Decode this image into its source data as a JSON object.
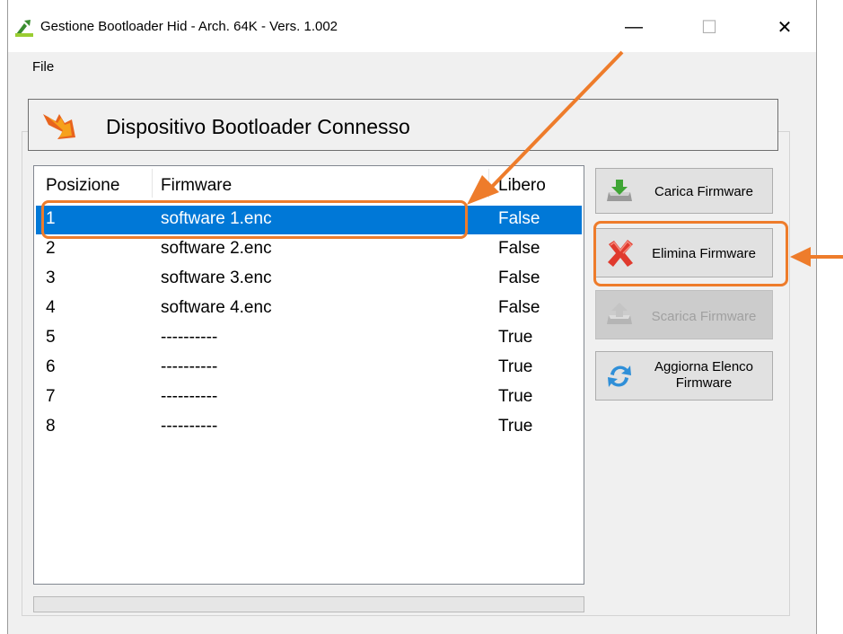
{
  "window": {
    "title": "Gestione Bootloader Hid - Arch. 64K - Vers. 1.002",
    "minimize_glyph": "—",
    "maximize_glyph": "☐",
    "close_glyph": "✕"
  },
  "menu": {
    "file": "File"
  },
  "header": {
    "title": "Dispositivo Bootloader Connesso",
    "icon": "bootloader-arrow-icon"
  },
  "list": {
    "columns": [
      "Posizione",
      "Firmware",
      "Libero"
    ],
    "rows": [
      {
        "pos": "1",
        "firmware": "software 1.enc",
        "libero": "False",
        "selected": true
      },
      {
        "pos": "2",
        "firmware": "software 2.enc",
        "libero": "False",
        "selected": false
      },
      {
        "pos": "3",
        "firmware": "software 3.enc",
        "libero": "False",
        "selected": false
      },
      {
        "pos": "4",
        "firmware": "software 4.enc",
        "libero": "False",
        "selected": false
      },
      {
        "pos": "5",
        "firmware": "----------",
        "libero": "True",
        "selected": false
      },
      {
        "pos": "6",
        "firmware": "----------",
        "libero": "True",
        "selected": false
      },
      {
        "pos": "7",
        "firmware": "----------",
        "libero": "True",
        "selected": false
      },
      {
        "pos": "8",
        "firmware": "----------",
        "libero": "True",
        "selected": false
      }
    ]
  },
  "buttons": {
    "carica": "Carica Firmware",
    "elimina": "Elimina Firmware",
    "scarica": "Scarica Firmware",
    "aggiorna": "Aggiorna Elenco Firmware"
  },
  "colors": {
    "selection": "#0078d7",
    "annotation": "#ee7c2b"
  }
}
